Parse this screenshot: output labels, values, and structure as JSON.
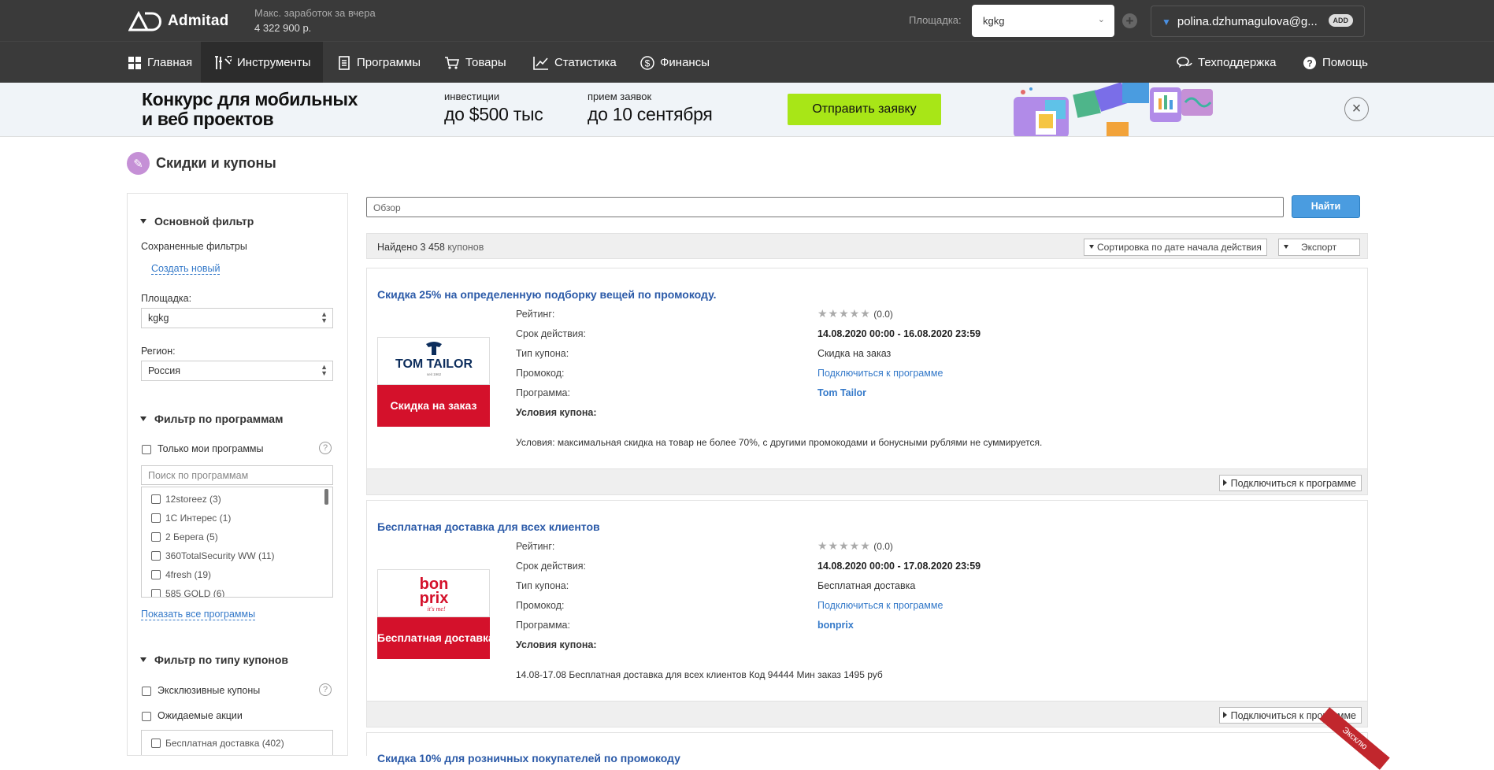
{
  "header": {
    "logo_text": "Admitad",
    "earnings_label": "Макс. заработок за вчера",
    "earnings_value": "4 322 900 р.",
    "platform_label": "Площадка:",
    "platform_value": "kgkg",
    "user_email": "polina.dzhumagulova@g...",
    "user_badge": "ADD"
  },
  "nav": {
    "items": [
      {
        "label": "Главная",
        "icon": "grid-icon"
      },
      {
        "label": "Инструменты",
        "icon": "tools-icon"
      },
      {
        "label": "Программы",
        "icon": "document-icon"
      },
      {
        "label": "Товары",
        "icon": "cart-icon"
      },
      {
        "label": "Статистика",
        "icon": "chart-icon"
      },
      {
        "label": "Финансы",
        "icon": "dollar-icon"
      }
    ],
    "support": "Техподдержка",
    "help": "Помощь"
  },
  "banner": {
    "title_line1": "Конкурс для мобильных",
    "title_line2": "и веб проектов",
    "invest_small": "инвестиции",
    "invest_big": "до $500 тыс",
    "deadline_small": "прием заявок",
    "deadline_big": "до 10 сентября",
    "cta": "Отправить заявку"
  },
  "page": {
    "title": "Скидки и купоны"
  },
  "sidebar": {
    "main_filter": "Основной фильтр",
    "saved_filters": "Сохраненные фильтры",
    "create_new": "Создать новый",
    "platform_label": "Площадка:",
    "platform_value": "kgkg",
    "region_label": "Регион:",
    "region_value": "Россия",
    "program_filter": "Фильтр по программам",
    "only_mine": "Только мои программы",
    "search_placeholder": "Поиск по программам",
    "programs": [
      "12storeez (3)",
      "1С Интерес (1)",
      "2 Берега (5)",
      "360TotalSecurity WW (11)",
      "4fresh (19)",
      "585 GOLD (6)"
    ],
    "show_all": "Показать все программы",
    "coupon_type_filter": "Фильтр по типу купонов",
    "exclusive": "Эксклюзивные купоны",
    "expected": "Ожидаемые акции",
    "free_delivery": "Бесплатная доставка (402)"
  },
  "search": {
    "value": "Обзор",
    "button": "Найти"
  },
  "results": {
    "found_prefix": "Найдено 3 458",
    "found_suffix": "купонов",
    "sort_label": "Сортировка по дате начала действия",
    "export_label": "Экспорт"
  },
  "labels": {
    "rating": "Рейтинг:",
    "validity": "Срок действия:",
    "coupon_type": "Тип купона:",
    "promocode": "Промокод:",
    "program": "Программа:",
    "conditions": "Условия купона:",
    "connect": "Подключиться к программе"
  },
  "coupons": [
    {
      "title": "Скидка 25% на определенную подборку вещей по промокоду.",
      "rating_stars": "★★★★★",
      "rating": "(0.0)",
      "validity": "14.08.2020 00:00 - 16.08.2020 23:59",
      "type": "Скидка на заказ",
      "promocode": "Подключиться к программе",
      "program": "Tom Tailor",
      "conditions": "Условия: максимальная скидка на товар не более 70%, с другими промокодами и бонусными рублями не суммируется.",
      "badge": "Скидка на заказ",
      "logo_main": "TOM TAILOR",
      "logo_sub": "seit 1962"
    },
    {
      "title": "Бесплатная доставка для всех клиентов",
      "rating_stars": "★★★★★",
      "rating": "(0.0)",
      "validity": "14.08.2020 00:00 - 17.08.2020 23:59",
      "type": "Бесплатная доставка",
      "promocode": "Подключиться к программе",
      "program": "bonprix",
      "conditions": "14.08-17.08 Бесплатная доставка для всех клиентов Код 94444 Мин заказ 1495 руб",
      "badge": "Бесплатная доставка",
      "logo_main_1": "bon",
      "logo_main_2": "prix",
      "logo_sub": "it's me!"
    }
  ],
  "next_card_title": "Скидка 10% для розничных покупателей по промокоду",
  "exclusive_ribbon": "Эксклю",
  "colors": {
    "topbar": "#3a3a3a",
    "link": "#3479c9",
    "title": "#2b5aa8",
    "cta": "#a8e617",
    "coupon_badge": "#d4112b"
  }
}
